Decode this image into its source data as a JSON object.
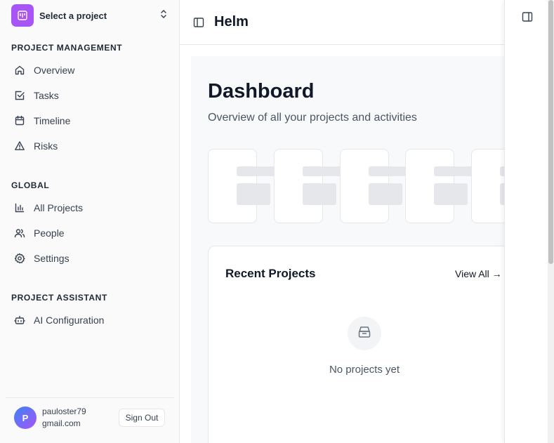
{
  "sidebar": {
    "project_select_label": "Select a project",
    "sections": {
      "project_management": "PROJECT MANAGEMENT",
      "global": "GLOBAL",
      "assistant": "PROJECT ASSISTANT"
    },
    "items": {
      "overview": "Overview",
      "tasks": "Tasks",
      "timeline": "Timeline",
      "risks": "Risks",
      "all_projects": "All Projects",
      "people": "People",
      "settings": "Settings",
      "ai_config": "AI Configuration"
    },
    "user": {
      "initial": "P",
      "name_line1": "pauloster79",
      "name_line2": "gmail.com",
      "sign_out": "Sign Out"
    }
  },
  "header": {
    "title": "Helm"
  },
  "main": {
    "title": "Dashboard",
    "subtitle": "Overview of all your projects and activities",
    "recent": {
      "title": "Recent Projects",
      "view_all": "View All →",
      "empty": "No projects yet"
    }
  },
  "colors": {
    "brand": "#a855f7",
    "avatar_from": "#3b82f6",
    "avatar_to": "#a855f7"
  }
}
